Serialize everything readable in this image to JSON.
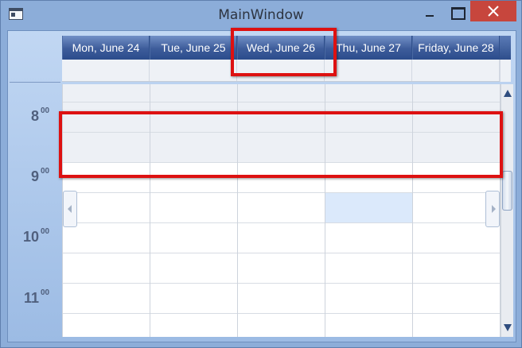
{
  "window": {
    "title": "MainWindow",
    "controls": [
      "minimize-icon",
      "maximize-icon",
      "close-icon"
    ],
    "close_color": "#c7463d"
  },
  "calendar": {
    "days": [
      {
        "label": "Mon, June 24"
      },
      {
        "label": "Tue, June 25"
      },
      {
        "label": "Wed, June 26"
      },
      {
        "label": "Thu, June 27"
      },
      {
        "label": "Friday, June 28"
      }
    ],
    "hours": [
      {
        "hour": "8",
        "minutes": "00"
      },
      {
        "hour": "9",
        "minutes": "00"
      },
      {
        "hour": "10",
        "minutes": "00"
      },
      {
        "hour": "11",
        "minutes": "00"
      }
    ],
    "header_color": "#3d5c9a",
    "selected_cell_color": "#dbe9fb"
  },
  "annotations": {
    "color": "#dd1111",
    "highlighted": [
      "Wed, June 26 header",
      "8:00 time slot row"
    ]
  }
}
